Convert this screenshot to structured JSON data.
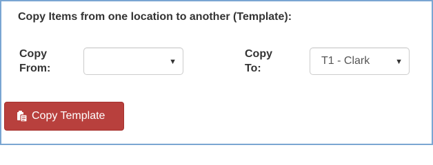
{
  "form": {
    "heading": "Copy Items from one location to another (Template):",
    "copy_from": {
      "label_line1": "Copy",
      "label_line2": "From:",
      "selected": ""
    },
    "copy_to": {
      "label_line1": "Copy",
      "label_line2": "To:",
      "selected": "T1 - Clark"
    },
    "button": {
      "label": "Copy Template",
      "icon": "clipboard-copy-icon"
    }
  },
  "colors": {
    "button_bg": "#b8403d",
    "frame_border": "#7aa6d2",
    "text": "#333333"
  }
}
